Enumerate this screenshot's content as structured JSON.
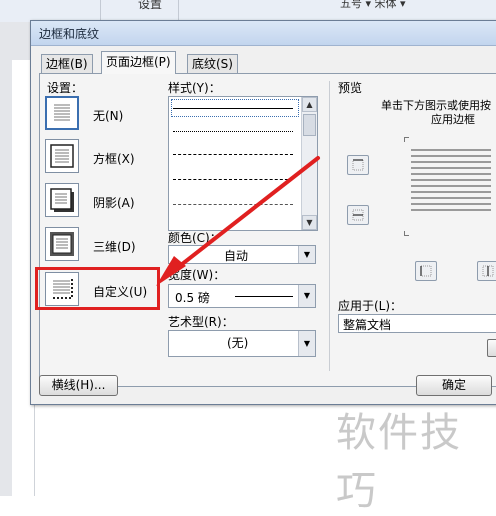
{
  "background": {
    "ribbon_label": "设置",
    "ribbon_font": "五号 ▾ 宋体 ▾",
    "watermark": "软件技巧"
  },
  "dialog": {
    "title": "边框和底纹",
    "tabs": [
      {
        "label": "边框(B)"
      },
      {
        "label": "页面边框(P)"
      },
      {
        "label": "底纹(S)"
      }
    ],
    "settings": {
      "label": "设置：",
      "items": [
        {
          "label": "无(N)"
        },
        {
          "label": "方框(X)"
        },
        {
          "label": "阴影(A)"
        },
        {
          "label": "三维(D)"
        },
        {
          "label": "自定义(U)"
        }
      ]
    },
    "style": {
      "label": "样式(Y)："
    },
    "color": {
      "label": "颜色(C)：",
      "value": "自动"
    },
    "width": {
      "label": "宽度(W)：",
      "value": "0.5 磅"
    },
    "art": {
      "label": "艺术型(R)：",
      "value": "(无)"
    },
    "preview": {
      "label": "预览",
      "hint_line1": "单击下方图示或使用按",
      "hint_line2": "应用边框"
    },
    "apply_to": {
      "label": "应用于(L)：",
      "value": "整篇文档"
    },
    "buttons": {
      "horizontal_line": "横线(H)...",
      "ok": "确定"
    }
  },
  "colors": {
    "callout_red": "#e02020",
    "titlebar": "#c2d5ee"
  }
}
